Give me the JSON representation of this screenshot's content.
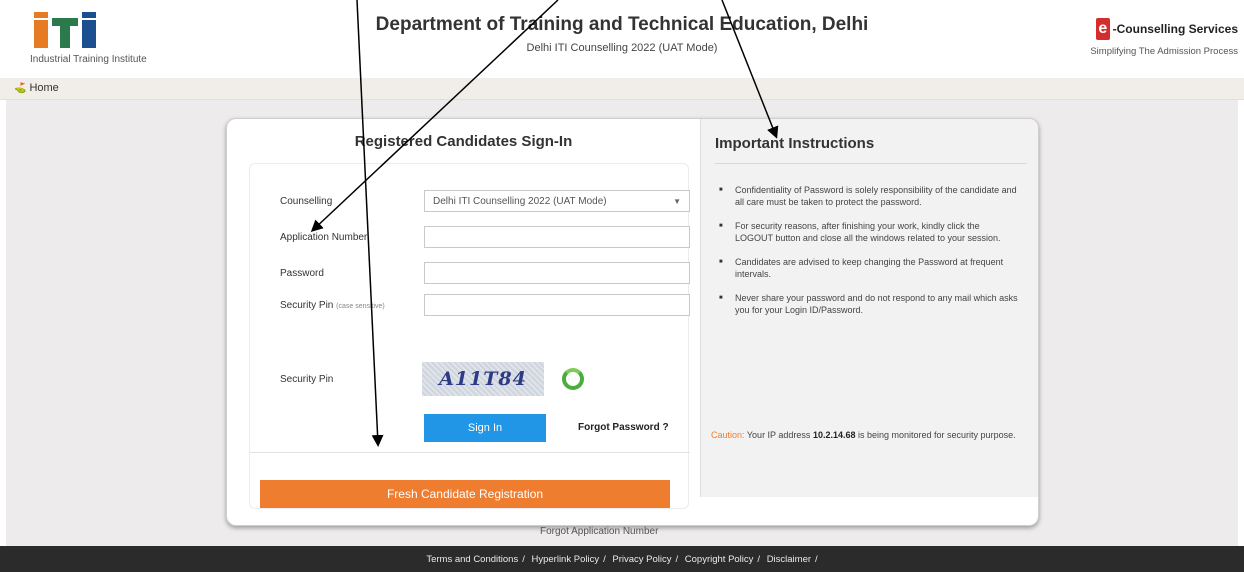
{
  "header": {
    "logo_text": "iti",
    "logo_caption": "Industrial Training Institute",
    "title": "Department of Training and Technical Education, Delhi",
    "subtitle": "Delhi ITI Counselling 2022 (UAT Mode)",
    "ec_letter": "e",
    "ec_name": "-Counselling Services",
    "ec_tagline": "Simplifying The Admission Process"
  },
  "nav": {
    "home_label": "Home",
    "home_icon": "home-icon"
  },
  "signin": {
    "title": "Registered Candidates Sign-In",
    "counselling_label": "Counselling",
    "counselling_value": "Delhi ITI Counselling 2022 (UAT Mode)",
    "appno_label": "Application Number",
    "appno_value": "",
    "password_label": "Password",
    "password_value": "",
    "secpin_input_label": "Security Pin",
    "secpin_hint": "(case sensitive)",
    "secpin_value": "",
    "secpin_label": "Security Pin",
    "captcha_text": "A11T84",
    "signin_button": "Sign In",
    "forgot_password": "Forgot Password ?",
    "register_button": "Fresh Candidate Registration",
    "forgot_appno": "Forgot Application Number"
  },
  "instructions": {
    "title": "Important Instructions",
    "items": [
      "Confidentiality of Password is solely responsibility of the candidate and all care must be taken to protect the password.",
      "For security reasons, after finishing your work, kindly click the LOGOUT button and close all the windows related to your session.",
      "Candidates are advised to keep changing the Password at frequent intervals.",
      "Never share your password and do not respond to any mail which asks you for your Login ID/Password."
    ],
    "caution_word": "Caution:",
    "caution_pre": "Your IP address",
    "caution_ip": "10.2.14.68",
    "caution_post": "is being monitored for security purpose."
  },
  "footer": {
    "links": [
      "Terms and Conditions",
      "Hyperlink Policy",
      "Privacy Policy",
      "Copyright Policy",
      "Disclaimer"
    ],
    "separator": "/"
  },
  "colors": {
    "accent_orange": "#ef7d2f",
    "signin_blue": "#2196e6",
    "refresh_green": "#4bad3d"
  }
}
